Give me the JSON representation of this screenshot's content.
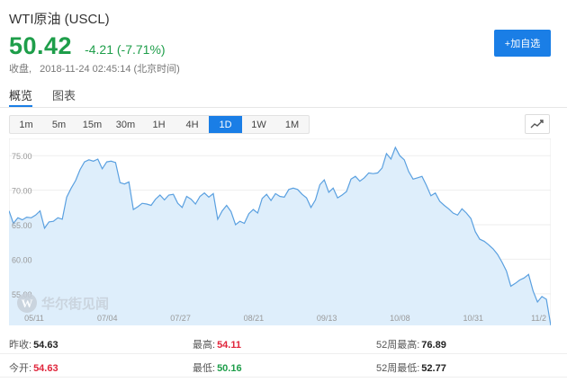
{
  "header": {
    "title": "WTI原油 (USCL)",
    "price": "50.42",
    "change": "-4.21 (-7.71%)",
    "close_label": "收盘,",
    "close_time": "2018-11-24 02:45:14 (北京时间)",
    "add_button": "+加自选",
    "price_color": "#1e9e4a",
    "accent_color": "#1a7ee6"
  },
  "nav": {
    "tabs": [
      "概览",
      "图表"
    ],
    "active": "概览"
  },
  "range": {
    "options": [
      "1m",
      "5m",
      "15m",
      "30m",
      "1H",
      "4H",
      "1D",
      "1W",
      "1M"
    ],
    "active": "1D",
    "chart_type_icon": "line-chart-icon"
  },
  "watermark": {
    "logo_letter": "W",
    "text": "华尔街见闻"
  },
  "chart_data": {
    "type": "area",
    "x_ticks": [
      "05/11",
      "07/04",
      "07/27",
      "08/21",
      "09/13",
      "10/08",
      "10/31",
      "11/2"
    ],
    "y_ticks": [
      "55.00",
      "60.00",
      "65.00",
      "70.00",
      "75.00"
    ],
    "ylim": [
      50.42,
      77.5
    ],
    "grid": "horizontal",
    "line_color": "#5aa0e0",
    "fill_color": "#deeefb",
    "values": [
      67.0,
      65.2,
      66.0,
      65.7,
      66.1,
      66.0,
      66.4,
      67.0,
      64.5,
      65.4,
      65.5,
      66.0,
      65.8,
      69.0,
      70.3,
      71.4,
      73.0,
      74.1,
      74.4,
      74.2,
      74.5,
      73.1,
      74.1,
      74.2,
      74.0,
      71.1,
      70.9,
      71.2,
      67.2,
      67.6,
      68.1,
      68.0,
      67.8,
      68.7,
      69.3,
      68.6,
      69.3,
      69.4,
      68.1,
      67.5,
      69.1,
      68.7,
      68.0,
      69.1,
      69.6,
      69.0,
      69.5,
      65.8,
      67.0,
      67.8,
      66.9,
      65.0,
      65.5,
      65.2,
      66.6,
      67.2,
      66.7,
      68.8,
      69.4,
      68.5,
      69.5,
      69.1,
      69.0,
      70.1,
      70.3,
      70.1,
      69.4,
      68.9,
      67.5,
      68.6,
      70.8,
      71.5,
      69.7,
      70.3,
      68.9,
      69.3,
      69.8,
      71.6,
      72.0,
      71.3,
      71.8,
      72.5,
      72.4,
      72.5,
      73.2,
      75.3,
      74.5,
      76.2,
      75.0,
      74.4,
      72.7,
      71.6,
      71.8,
      72.0,
      70.7,
      69.2,
      69.6,
      68.4,
      67.8,
      67.3,
      66.7,
      66.4,
      67.3,
      66.7,
      65.9,
      64.0,
      62.9,
      62.6,
      62.1,
      61.5,
      60.7,
      59.6,
      58.3,
      56.1,
      56.5,
      57.0,
      57.3,
      57.8,
      55.4,
      53.8,
      54.6,
      54.2,
      50.4
    ]
  },
  "stats": {
    "prev_close_label": "昨收:",
    "prev_close": "54.63",
    "high_label": "最高:",
    "high": "54.11",
    "w52_high_label": "52周最高:",
    "w52_high": "76.89",
    "open_label": "今开:",
    "open": "54.63",
    "low_label": "最低:",
    "low": "50.16",
    "w52_low_label": "52周最低:",
    "w52_low": "52.77"
  }
}
